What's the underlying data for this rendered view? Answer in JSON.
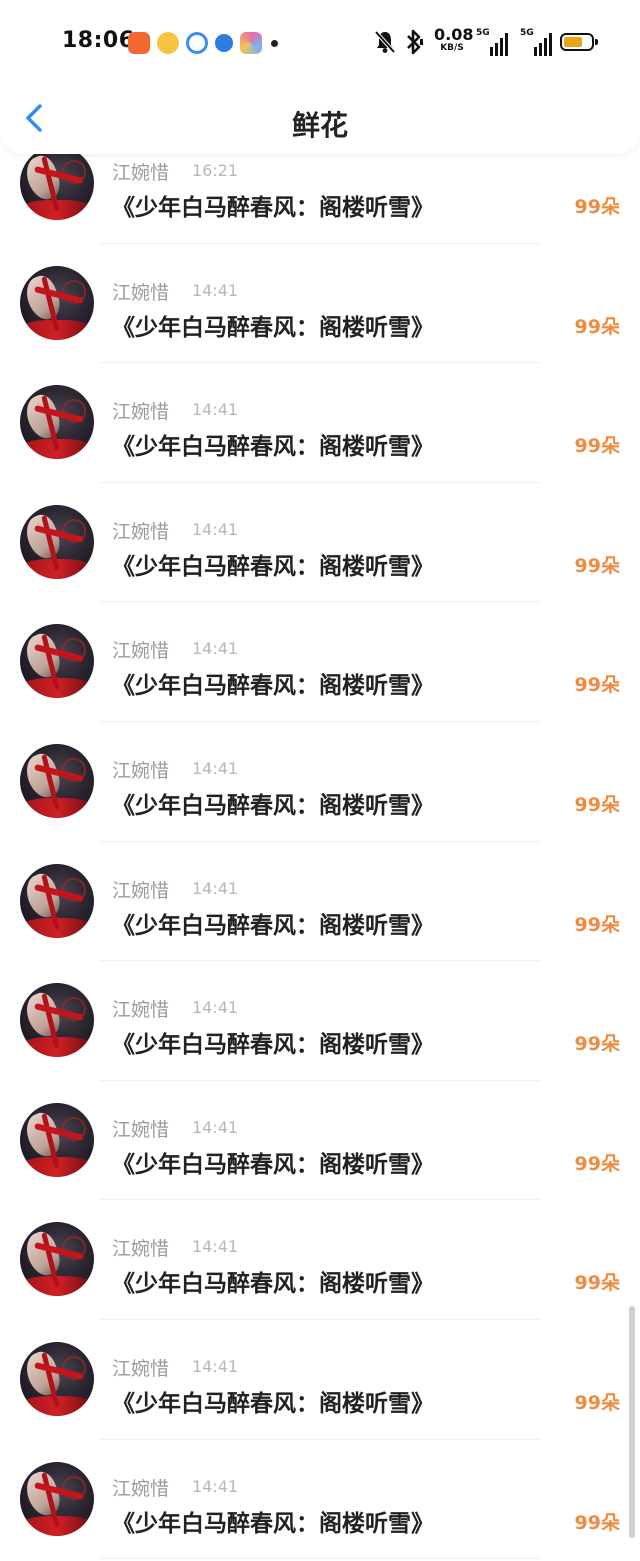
{
  "status_bar": {
    "time": "18:06",
    "net_speed": "0.08",
    "net_unit": "KB/S",
    "sim1": "5G",
    "sim2": "5G",
    "app_icons": [
      {
        "name": "mail-app-icon",
        "color": "#f26a32"
      },
      {
        "name": "weibo-app-icon",
        "color": "#f4c340"
      },
      {
        "name": "browser-app-icon",
        "color": "#3c8df2"
      },
      {
        "name": "compass-app-icon",
        "color": "#2f7be0"
      },
      {
        "name": "gallery-app-icon",
        "color": "#e76fa3"
      }
    ],
    "battery_color": "#e8a317"
  },
  "header": {
    "title": "鲜花",
    "back_color": "#2b8ef0"
  },
  "items": [
    {
      "name": "江婉惜",
      "time": "16:21",
      "book": "《少年白马醉春风：阁楼听雪》",
      "count": "99朵"
    },
    {
      "name": "江婉惜",
      "time": "14:41",
      "book": "《少年白马醉春风：阁楼听雪》",
      "count": "99朵"
    },
    {
      "name": "江婉惜",
      "time": "14:41",
      "book": "《少年白马醉春风：阁楼听雪》",
      "count": "99朵"
    },
    {
      "name": "江婉惜",
      "time": "14:41",
      "book": "《少年白马醉春风：阁楼听雪》",
      "count": "99朵"
    },
    {
      "name": "江婉惜",
      "time": "14:41",
      "book": "《少年白马醉春风：阁楼听雪》",
      "count": "99朵"
    },
    {
      "name": "江婉惜",
      "time": "14:41",
      "book": "《少年白马醉春风：阁楼听雪》",
      "count": "99朵"
    },
    {
      "name": "江婉惜",
      "time": "14:41",
      "book": "《少年白马醉春风：阁楼听雪》",
      "count": "99朵"
    },
    {
      "name": "江婉惜",
      "time": "14:41",
      "book": "《少年白马醉春风：阁楼听雪》",
      "count": "99朵"
    },
    {
      "name": "江婉惜",
      "time": "14:41",
      "book": "《少年白马醉春风：阁楼听雪》",
      "count": "99朵"
    },
    {
      "name": "江婉惜",
      "time": "14:41",
      "book": "《少年白马醉春风：阁楼听雪》",
      "count": "99朵"
    },
    {
      "name": "江婉惜",
      "time": "14:41",
      "book": "《少年白马醉春风：阁楼听雪》",
      "count": "99朵"
    },
    {
      "name": "江婉惜",
      "time": "14:41",
      "book": "《少年白马醉春风：阁楼听雪》",
      "count": "99朵"
    }
  ],
  "colors": {
    "accent": "#f08a3e",
    "name_gray": "#9b9b9b",
    "time_gray": "#b7b7b7"
  }
}
